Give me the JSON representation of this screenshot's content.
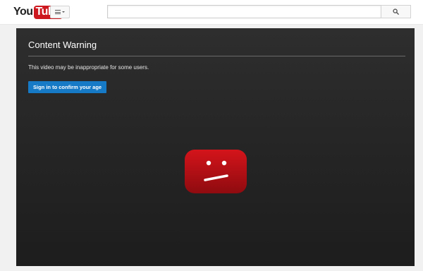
{
  "masthead": {
    "logo_you": "You",
    "logo_tube": "Tube",
    "guide_icon": "hamburger-menu-icon",
    "search": {
      "value": "",
      "placeholder": ""
    },
    "search_icon": "search-icon"
  },
  "player": {
    "title": "Content Warning",
    "message": "This video may be inappropriate for some users.",
    "sign_in_label": "Sign in to confirm your age",
    "error_icon": "sad-play-button-icon"
  },
  "colors": {
    "brand_red": "#cc181e",
    "button_blue": "#167ac6",
    "player_bg": "#262626"
  }
}
